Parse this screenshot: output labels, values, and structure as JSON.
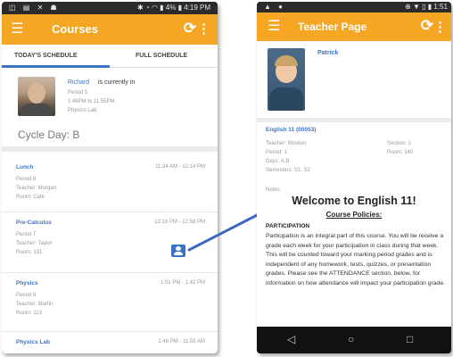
{
  "left_phone": {
    "status_bar": {
      "icons_left": "◫ ▤ ✕ ☗",
      "icons_right": "✱ ◔ ◠ ▮ 4% ▮",
      "time": "4:19 PM"
    },
    "app_bar": {
      "title": "Courses",
      "menu_icon": "menu-icon",
      "sync_icon": "sync-icon",
      "more_icon": "more-icon"
    },
    "tabs": [
      {
        "label": "TODAY'S SCHEDULE",
        "active": true
      },
      {
        "label": "FULL SCHEDULE",
        "active": false
      }
    ],
    "current_class": {
      "teacher_name": "Richard",
      "status_text": "is currently in",
      "period": "Period 5",
      "time": "1:46PM to 11:55PM",
      "room": "Physics Lab",
      "cycle_day": "Cycle Day: B"
    },
    "schedule": [
      {
        "name": "Lunch",
        "time": "11:34 AM - 12:14 PM",
        "details": [
          "Period 6",
          "Teacher: Morgan",
          "Room: Cafe"
        ]
      },
      {
        "name": "Pre-Calculus",
        "time": "12:18 PM - 12:58 PM",
        "details": [
          "Period 7",
          "Teacher: Taylor",
          "Room: 131"
        ]
      },
      {
        "name": "Physics",
        "time": "1:01 PM - 1:42 PM",
        "details": [
          "Period 8",
          "Teacher: Martin",
          "Room: 113"
        ]
      },
      {
        "name": "Physics Lab",
        "time": "1:46 PM - 11:55 AM",
        "details": []
      }
    ]
  },
  "right_phone": {
    "status_bar": {
      "icons_left": "▲ ●",
      "icons_right": "⊕ ▼ ▯ ▮ 1:51"
    },
    "app_bar": {
      "title": "Teacher Page",
      "menu_icon": "menu-icon",
      "sync_icon": "sync-icon",
      "more_icon": "more-icon"
    },
    "student_name": "Patrick",
    "course": {
      "title": "English 11 (00053)",
      "teacher": "Teacher: Wooten",
      "period": "Period: 1",
      "days": "Days: A,B",
      "semesters": "Semesters: S1, S2",
      "section": "Section: 1",
      "room": "Room: 140"
    },
    "notes_label": "Notes:",
    "welcome": "Welcome to English 11!",
    "policies_heading": "Course Policies:",
    "participation_heading": "PARTICIPATION",
    "participation_body": "Participation is an integral part of this course. You will be receive a grade each week for your participation in class during that week. This will be counted toward your marking period grades and is independent of any homework, tests, quizzes, or presentation grades. Please see the ATTENDANCE section, below, for information on how attendance will impact your participation grade.",
    "nav": {
      "back": "◁",
      "home": "○",
      "recents": "□"
    }
  },
  "colors": {
    "accent": "#f5a623",
    "link": "#3b74c7",
    "arrow": "#3b68c0"
  }
}
